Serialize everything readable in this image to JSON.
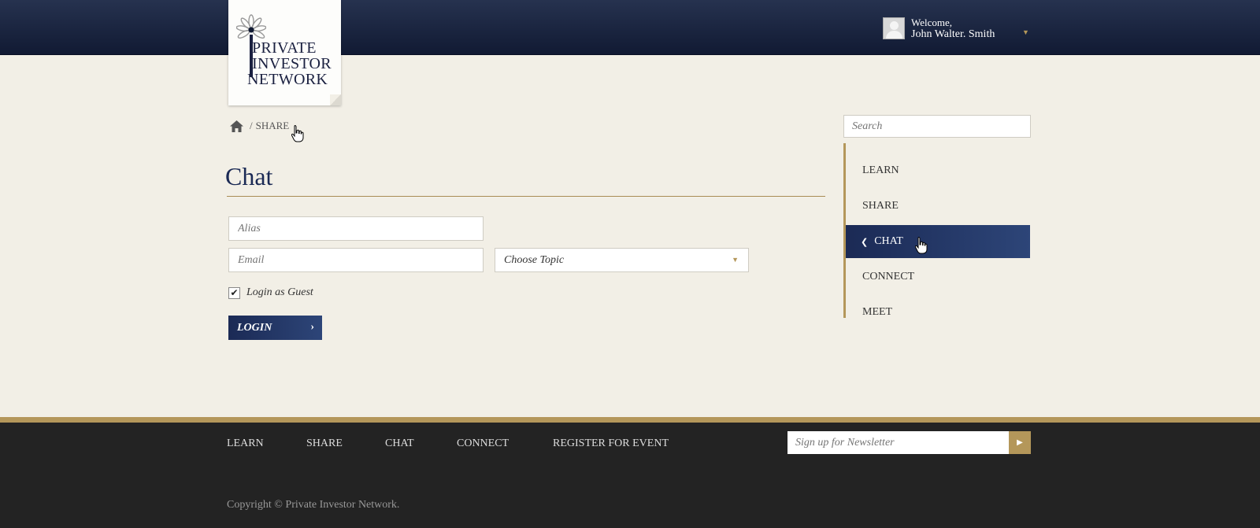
{
  "header": {
    "welcome": "Welcome,",
    "username": "John Walter. Smith",
    "menu_icon": "caret-down-icon"
  },
  "logo": {
    "line1": "PRIVATE",
    "line2": "INVESTOR",
    "line3": "NETWORK"
  },
  "breadcrumb": {
    "home_icon": "home-icon",
    "separator": "/",
    "current": "SHARE"
  },
  "main": {
    "title": "Chat",
    "alias_placeholder": "Alias",
    "email_placeholder": "Email",
    "topic_selected": "Choose Topic",
    "guest_label": "Login as Guest",
    "guest_checked": true,
    "login_label": "LOGIN",
    "login_icon": "chevron-right-icon"
  },
  "sidebar": {
    "search_placeholder": "Search",
    "items": [
      {
        "label": "LEARN",
        "active": false
      },
      {
        "label": "SHARE",
        "active": false
      },
      {
        "label": "CHAT",
        "active": true
      },
      {
        "label": "CONNECT",
        "active": false
      },
      {
        "label": "MEET",
        "active": false
      }
    ]
  },
  "footer": {
    "links": [
      "LEARN",
      "SHARE",
      "CHAT",
      "CONNECT",
      "REGISTER FOR EVENT"
    ],
    "newsletter_placeholder": "Sign up for Newsletter",
    "newsletter_icon": "play-arrow-icon",
    "copyright": "Copyright © Private Investor Network."
  },
  "colors": {
    "navy": "#1b2a55",
    "gold": "#b4975a",
    "background": "#f2efe6",
    "footer": "#232323"
  }
}
